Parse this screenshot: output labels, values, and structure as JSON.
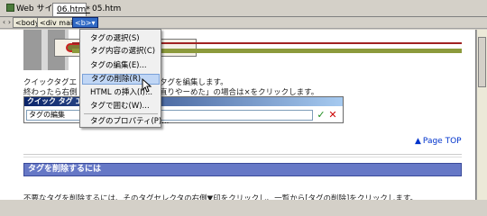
{
  "tabs": [
    {
      "label": "Web サイト"
    },
    {
      "label": "06.htm*"
    },
    {
      "label": "05.htm"
    }
  ],
  "tag_selector": {
    "chips": [
      "<body>",
      "<div main>",
      "<b>"
    ]
  },
  "document": {
    "hint_line1a": "クイックタグエ",
    "hint_line1b": "夕グを編集します。",
    "hint_line2a": "終わったら右側",
    "hint_line2b": "直りやーめた」の場合は×をクリックします。",
    "quick_tag_editor": {
      "title": "クイック タグ エ",
      "field_value": "タグの編集"
    },
    "page_top_label": "Page TOP",
    "section_heading": "タグを削除するには",
    "body_text": "不要なタグを削除するには、そのタグセレクタの右側▼印をクリックし、一覧から[タグの削除]をクリックします。"
  },
  "context_menu": {
    "items": [
      {
        "label": "タグの選択(S)"
      },
      {
        "label": "タグ内容の選択(C)"
      },
      {
        "label": "タグの編集(E)..."
      },
      {
        "label": "タグの削除(R)",
        "highlighted": true
      },
      {
        "label": "HTML の挿入(I)..."
      },
      {
        "label": "タグで囲む(W)..."
      },
      {
        "label": "タグのプロパティ(P)..."
      }
    ]
  },
  "colors": {
    "menu_highlight": "#c0d6f5",
    "section_heading_bg": "#6678c6",
    "link": "#0033cc"
  }
}
